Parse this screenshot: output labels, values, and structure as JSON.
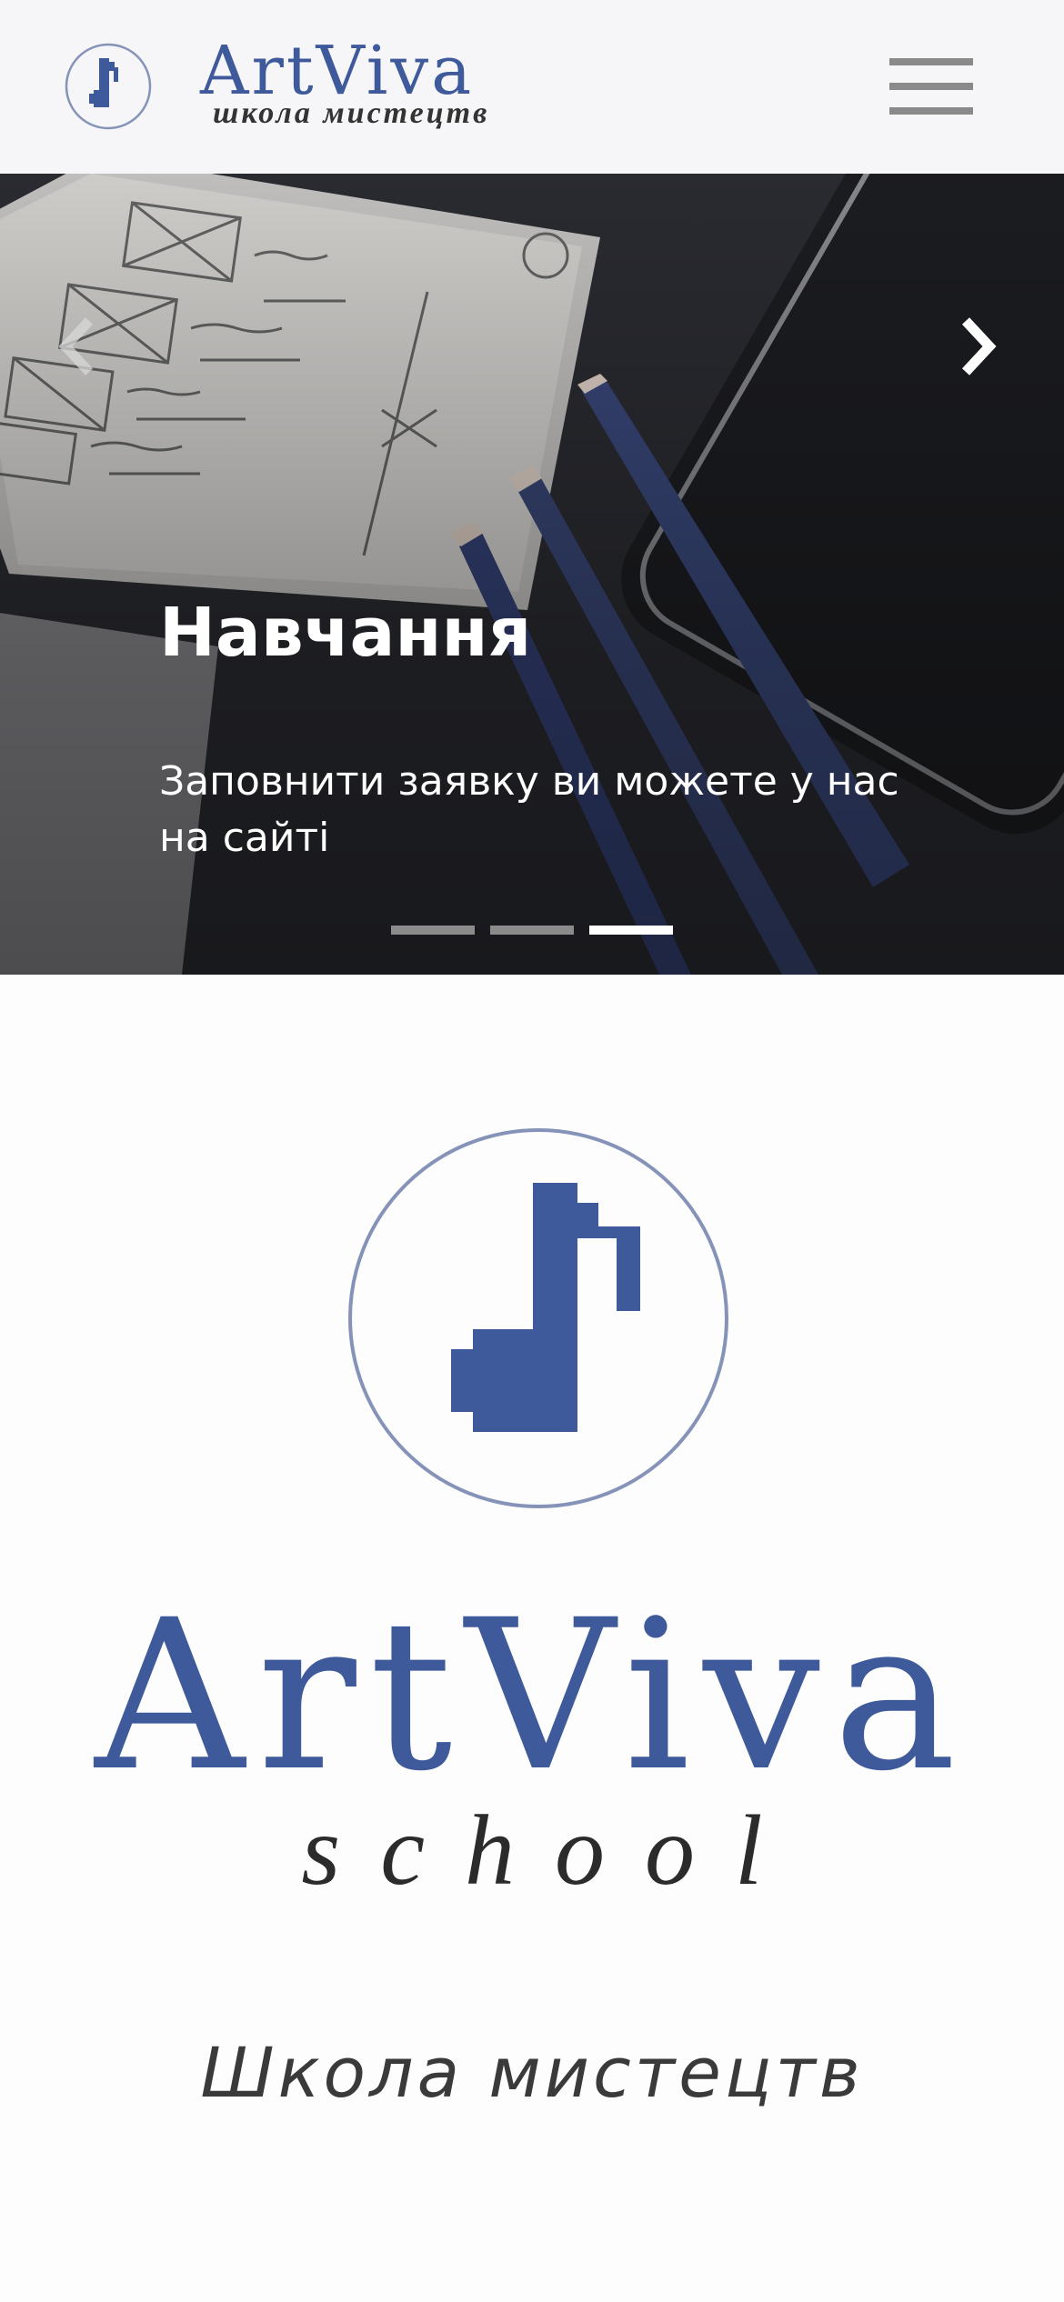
{
  "header": {
    "brand_name": "ArtViva",
    "brand_tagline": "школа мистецтв",
    "logo_icon": "music-note-icon",
    "menu_icon": "hamburger-menu-icon"
  },
  "carousel": {
    "prev_icon": "chevron-left-icon",
    "next_icon": "chevron-right-icon",
    "slide_title": "Навчання",
    "slide_text": "Заповнити заявку ви можете у нас на сайті",
    "slide_count": 3,
    "active_slide": 3
  },
  "main": {
    "logo_word": "ArtViva",
    "logo_subword": "school",
    "subtitle": "Школа мистецтв"
  },
  "colors": {
    "brand_blue": "#3e5a9a",
    "circle_outline": "#8593b8",
    "header_bg": "#f6f6f9"
  }
}
